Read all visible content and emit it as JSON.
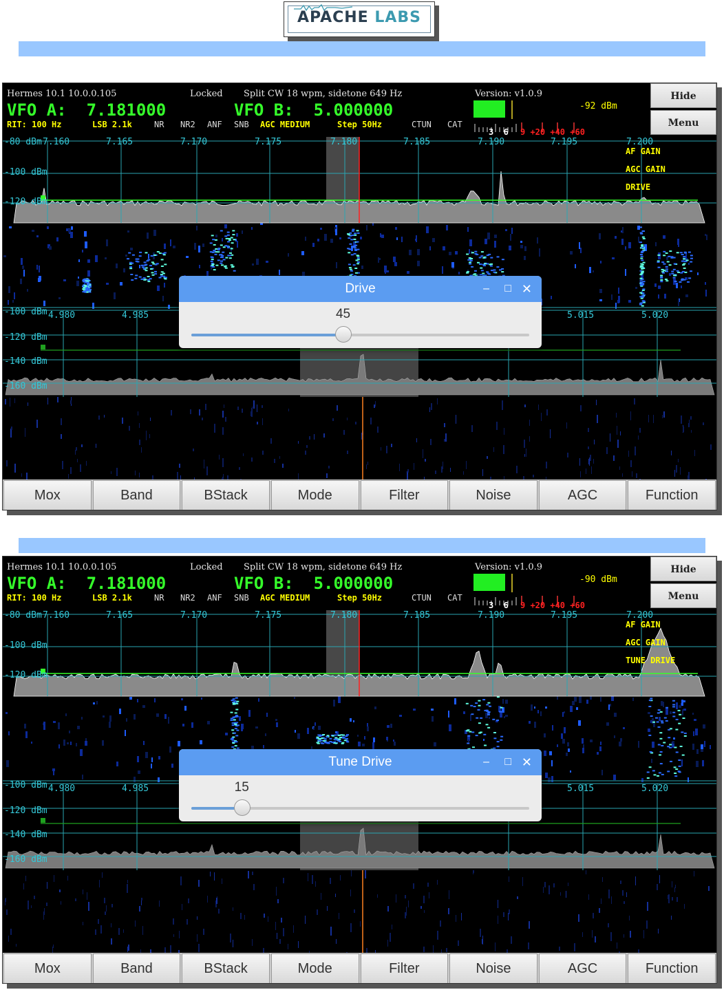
{
  "logo": {
    "part1": "APACHE",
    "part2": " LABS"
  },
  "screens": [
    {
      "status": {
        "radio": "Hermes 10.1 10.0.0.105",
        "lock": "Locked",
        "mode_info": "Split CW 18 wpm, sidetone 649 Hz",
        "version": "Version: v1.0.9"
      },
      "vfo_a": "VFO A:  7.181000",
      "vfo_b": "VFO B:  5.000000",
      "status2": {
        "rit": "RIT: 100 Hz",
        "filter": "LSB 2.1k",
        "nr": "NR",
        "nr2": "NR2",
        "anf": "ANF",
        "snb": "SNB",
        "agc": "AGC MEDIUM",
        "step": "Step 50Hz",
        "ctun": "CTUN",
        "cat": "CAT"
      },
      "meter": {
        "dbm": "-92 dBm",
        "scale_white": "3  6",
        "scale_red": "9 +20 +40 +60"
      },
      "buttons": {
        "hide": "Hide",
        "menu": "Menu"
      },
      "upper_freqs": [
        "7.160",
        "7.165",
        "7.170",
        "7.175",
        "7.180",
        "7.185",
        "7.190",
        "7.195",
        "7.200"
      ],
      "upper_dbm": [
        "-80 dBm",
        "-100 dBm",
        "-120 dBm"
      ],
      "overlay_labels": [
        "AF GAIN",
        "AGC GAIN",
        "DRIVE"
      ],
      "lower_freqs": [
        "4.980",
        "4.985",
        "5.015",
        "5.020"
      ],
      "lower_dbm": [
        "-100 dBm",
        "-120 dBm",
        "-140 dBm",
        "-160 dBm"
      ],
      "dialog": {
        "title": "Drive",
        "value": "45",
        "level": 45
      },
      "toolbar": [
        "Mox",
        "Band",
        "BStack",
        "Mode",
        "Filter",
        "Noise",
        "AGC",
        "Function"
      ],
      "colors": {
        "spectrum_line": "#35ff2a",
        "grid": "#2a8f9a",
        "dialog_title": "#5b9cf1"
      }
    },
    {
      "status": {
        "radio": "Hermes 10.1 10.0.0.105",
        "lock": "Locked",
        "mode_info": "Split CW 18 wpm, sidetone 649 Hz",
        "version": "Version: v1.0.9"
      },
      "vfo_a": "VFO A:  7.181000",
      "vfo_b": "VFO B:  5.000000",
      "status2": {
        "rit": "RIT: 100 Hz",
        "filter": "LSB 2.1k",
        "nr": "NR",
        "nr2": "NR2",
        "anf": "ANF",
        "snb": "SNB",
        "agc": "AGC MEDIUM",
        "step": "Step 50Hz",
        "ctun": "CTUN",
        "cat": "CAT"
      },
      "meter": {
        "dbm": "-90 dBm",
        "scale_white": "3  6",
        "scale_red": "9 +20 +40 +60"
      },
      "buttons": {
        "hide": "Hide",
        "menu": "Menu"
      },
      "upper_freqs": [
        "7.160",
        "7.165",
        "7.170",
        "7.175",
        "7.180",
        "7.185",
        "7.190",
        "7.195",
        "7.200"
      ],
      "upper_dbm": [
        "-80 dBm",
        "-100 dBm",
        "-120 dBm"
      ],
      "overlay_labels": [
        "AF GAIN",
        "AGC GAIN",
        "TUNE DRIVE"
      ],
      "lower_freqs": [
        "4.980",
        "4.985",
        "5.015",
        "5.020"
      ],
      "lower_dbm": [
        "-100 dBm",
        "-120 dBm",
        "-140 dBm",
        "-160 dBm"
      ],
      "dialog": {
        "title": "Tune Drive",
        "value": "15",
        "level": 15
      },
      "toolbar": [
        "Mox",
        "Band",
        "BStack",
        "Mode",
        "Filter",
        "Noise",
        "AGC",
        "Function"
      ],
      "colors": {
        "spectrum_line": "#35ff2a",
        "grid": "#2a8f9a",
        "dialog_title": "#5b9cf1"
      }
    }
  ]
}
